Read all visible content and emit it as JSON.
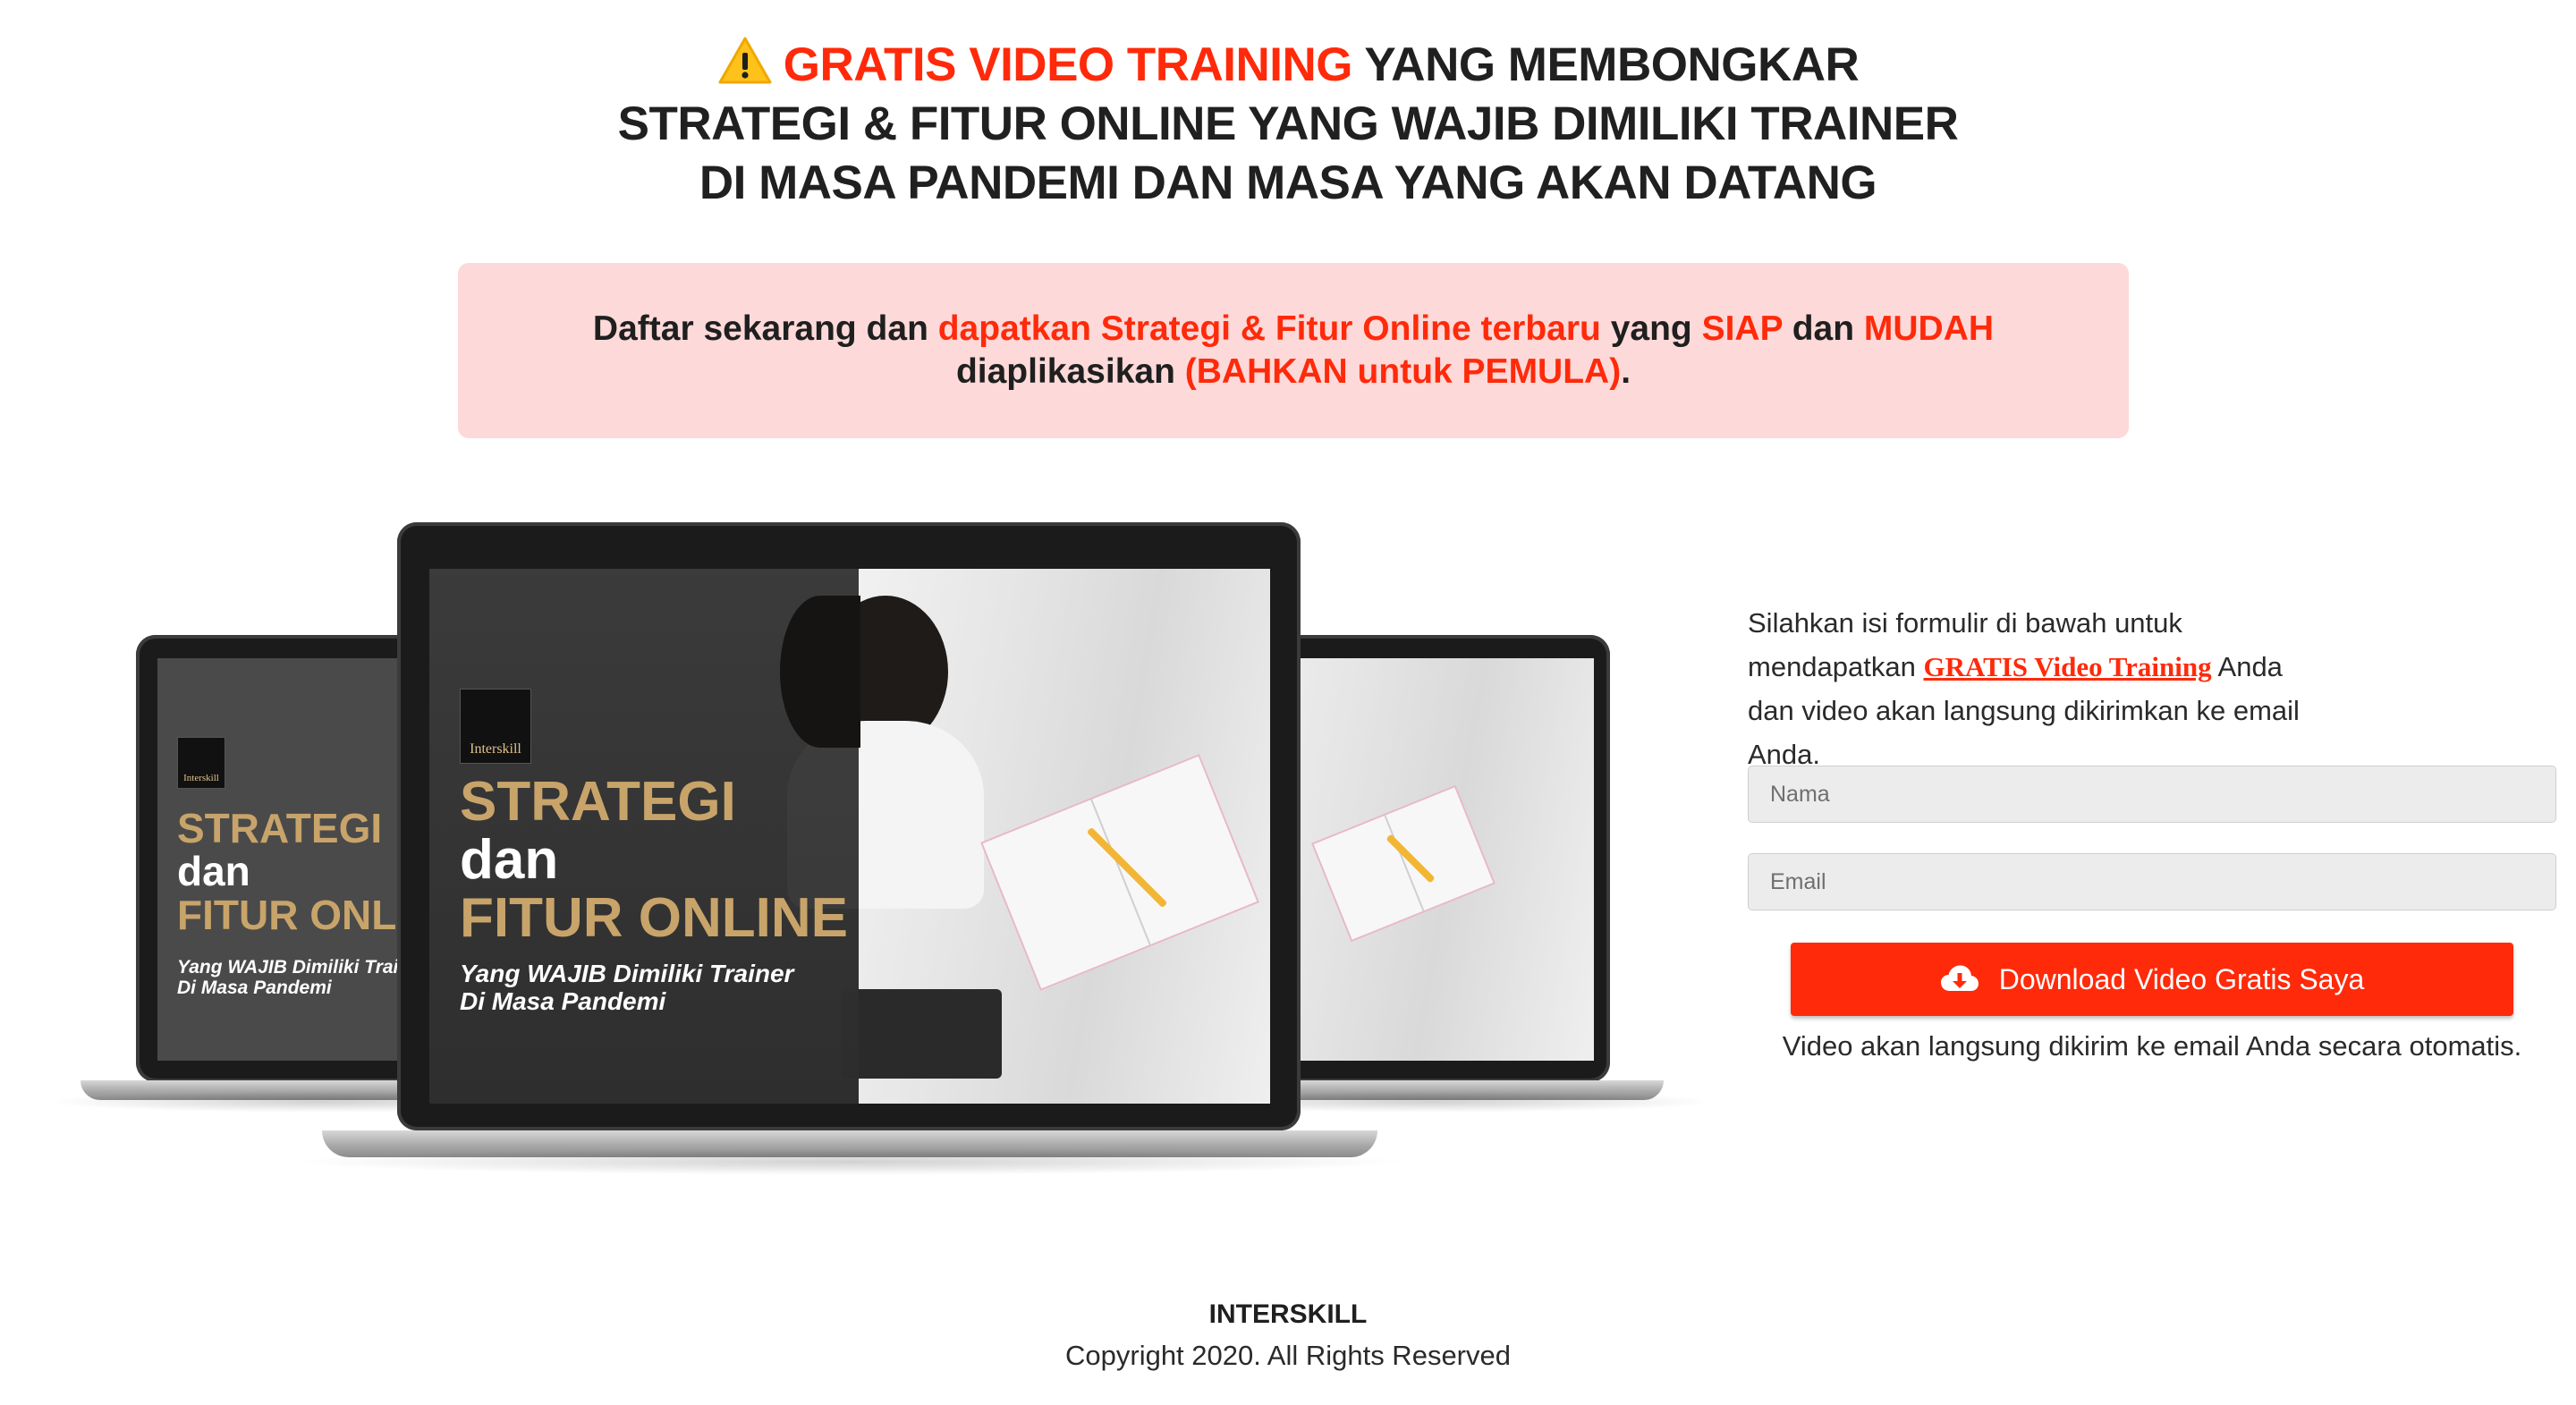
{
  "headline": {
    "red_part": "GRATIS VIDEO TRAINING",
    "line1_rest": " YANG MEMBONGKAR",
    "line2": "STRATEGI & FITUR ONLINE YANG WAJIB DIMILIKI TRAINER",
    "line3": "DI MASA PANDEMI DAN MASA YANG AKAN DATANG",
    "icon": "warning-icon"
  },
  "banner": {
    "t1": "Daftar sekarang dan ",
    "t2": "dapatkan Strategi & Fitur Online terbaru",
    "t3": " yang ",
    "t4": "SIAP",
    "t5": " dan ",
    "t6": "MUDAH",
    "t7": " diaplikasikan ",
    "t8": "(BAHKAN untuk PEMULA)",
    "t9": "."
  },
  "mockup": {
    "logo": "Interskill",
    "title_line1": "STRATEGI",
    "title_line2": "dan",
    "title_line3": "FITUR ONLINE",
    "left_title_line3": "FITUR ONLI",
    "subtitle_line1": "Yang WAJIB Dimiliki Trainer",
    "left_subtitle_line1": "Yang WAJIB Dimiliki Trair",
    "subtitle_line2": "Di Masa Pandemi"
  },
  "form": {
    "intro_before": "Silahkan isi formulir di bawah untuk mendapatkan ",
    "intro_link": "GRATIS Video Training",
    "intro_after": " Anda dan video akan langsung dikirimkan ke email Anda.",
    "name_placeholder": "Nama",
    "email_placeholder": "Email",
    "button_label": "Download Video Gratis Saya",
    "button_icon": "cloud-download-icon",
    "note": "Video akan langsung dikirim ke email Anda secara otomatis."
  },
  "footer": {
    "brand": "INTERSKILL",
    "copyright": "Copyright 2020. All Rights Reserved"
  },
  "colors": {
    "accent": "#ff2a0a",
    "banner_bg": "#fdd9d9",
    "mockup_title_gold": "#c8a46a"
  }
}
